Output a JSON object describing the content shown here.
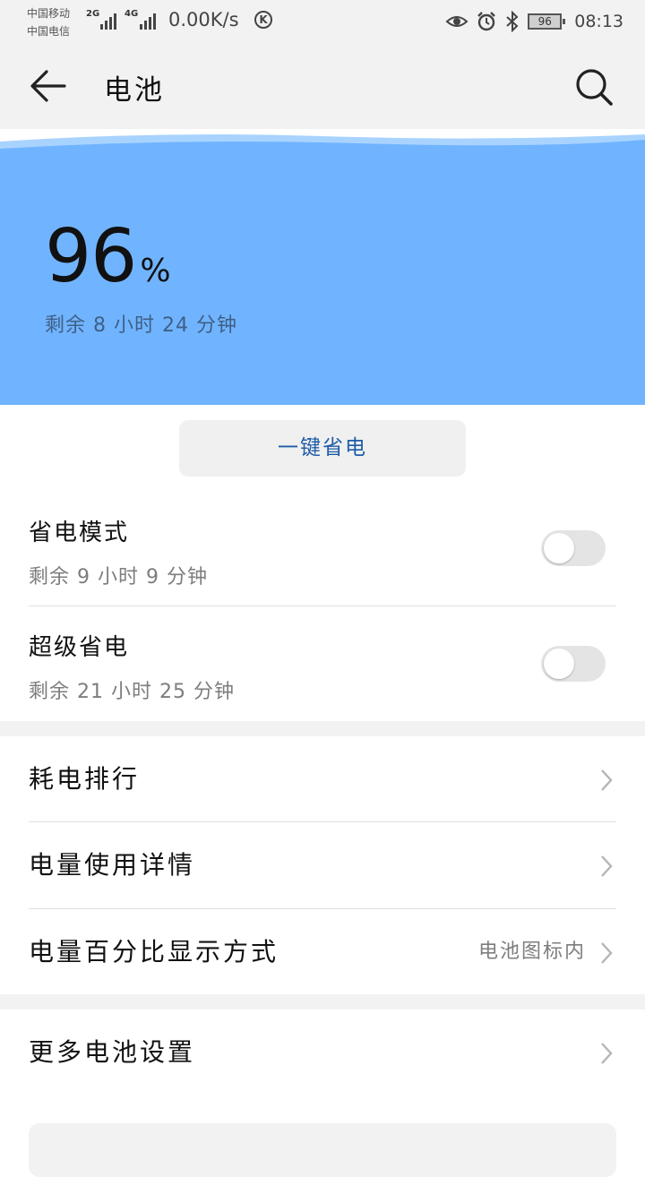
{
  "status_bar": {
    "carrier_1": "中国移动",
    "carrier_2": "中国电信",
    "network_1": "2G",
    "network_2": "4G",
    "speed": "0.00K/s",
    "k_badge": "K",
    "battery_level": "96",
    "time": "08:13",
    "icons": [
      "eye-icon",
      "alarm-icon",
      "bluetooth-icon",
      "battery-icon"
    ]
  },
  "header": {
    "title": "电池",
    "back_icon": "back-arrow-icon",
    "search_icon": "search-icon"
  },
  "battery": {
    "percent": "96",
    "percent_sign": "%",
    "remaining": "剩余 8 小时 24 分钟",
    "accent_color": "#70b4ff"
  },
  "save_button": {
    "label": "一键省电"
  },
  "modes": [
    {
      "title": "省电模式",
      "subtitle": "剩余 9 小时 9 分钟",
      "enabled": false
    },
    {
      "title": "超级省电",
      "subtitle": "剩余 21 小时 25 分钟",
      "enabled": false
    }
  ],
  "menu": [
    {
      "label": "耗电排行",
      "value": ""
    },
    {
      "label": "电量使用详情",
      "value": ""
    },
    {
      "label": "电量百分比显示方式",
      "value": "电池图标内"
    }
  ],
  "more": {
    "label": "更多电池设置"
  }
}
